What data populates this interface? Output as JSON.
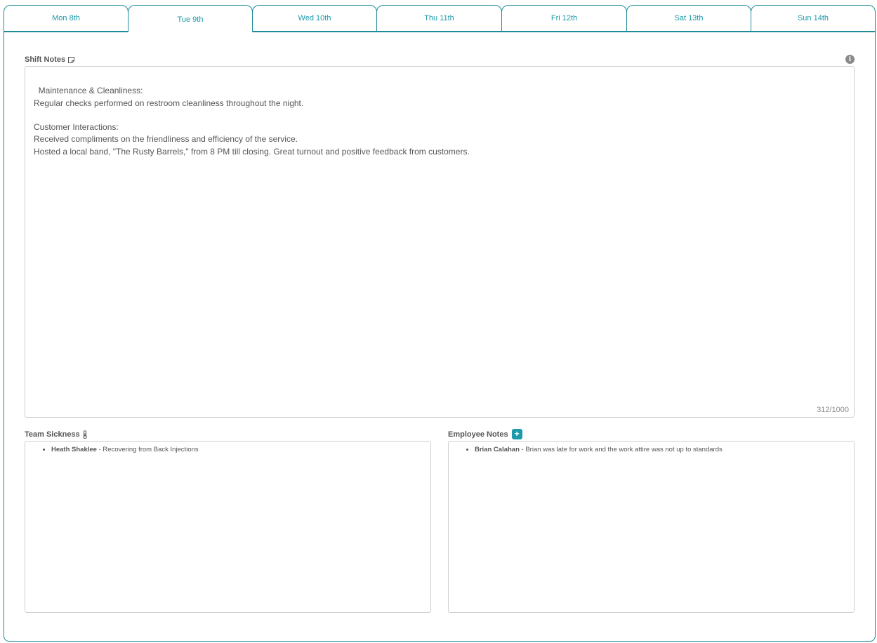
{
  "tabs": [
    {
      "label": "Mon 8th",
      "active": false
    },
    {
      "label": "Tue 9th",
      "active": true
    },
    {
      "label": "Wed 10th",
      "active": false
    },
    {
      "label": "Thu 11th",
      "active": false
    },
    {
      "label": "Fri 12th",
      "active": false
    },
    {
      "label": "Sat 13th",
      "active": false
    },
    {
      "label": "Sun 14th",
      "active": false
    }
  ],
  "shift_notes": {
    "label": "Shift Notes",
    "icon": "note-icon",
    "text": "Maintenance & Cleanliness:\nRegular checks performed on restroom cleanliness throughout the night.\n\nCustomer Interactions:\nReceived compliments on the friendliness and efficiency of the service.\nHosted a local band, \"The Rusty Barrels,\" from 8 PM till closing. Great turnout and positive feedback from customers.",
    "counter": "312/1000"
  },
  "team_sickness": {
    "label": "Team Sickness",
    "icon": "thermometer-icon",
    "items": [
      {
        "name": "Heath Shaklee",
        "note": " - Recovering from Back Injections"
      }
    ]
  },
  "employee_notes": {
    "label": "Employee Notes",
    "add_label": "+",
    "items": [
      {
        "name": "Brian Calahan",
        "note": " - Brian was late for work and the work attire was not up to standards"
      }
    ]
  },
  "colors": {
    "accent": "#1b9aaa",
    "border": "#1f8b9a"
  }
}
